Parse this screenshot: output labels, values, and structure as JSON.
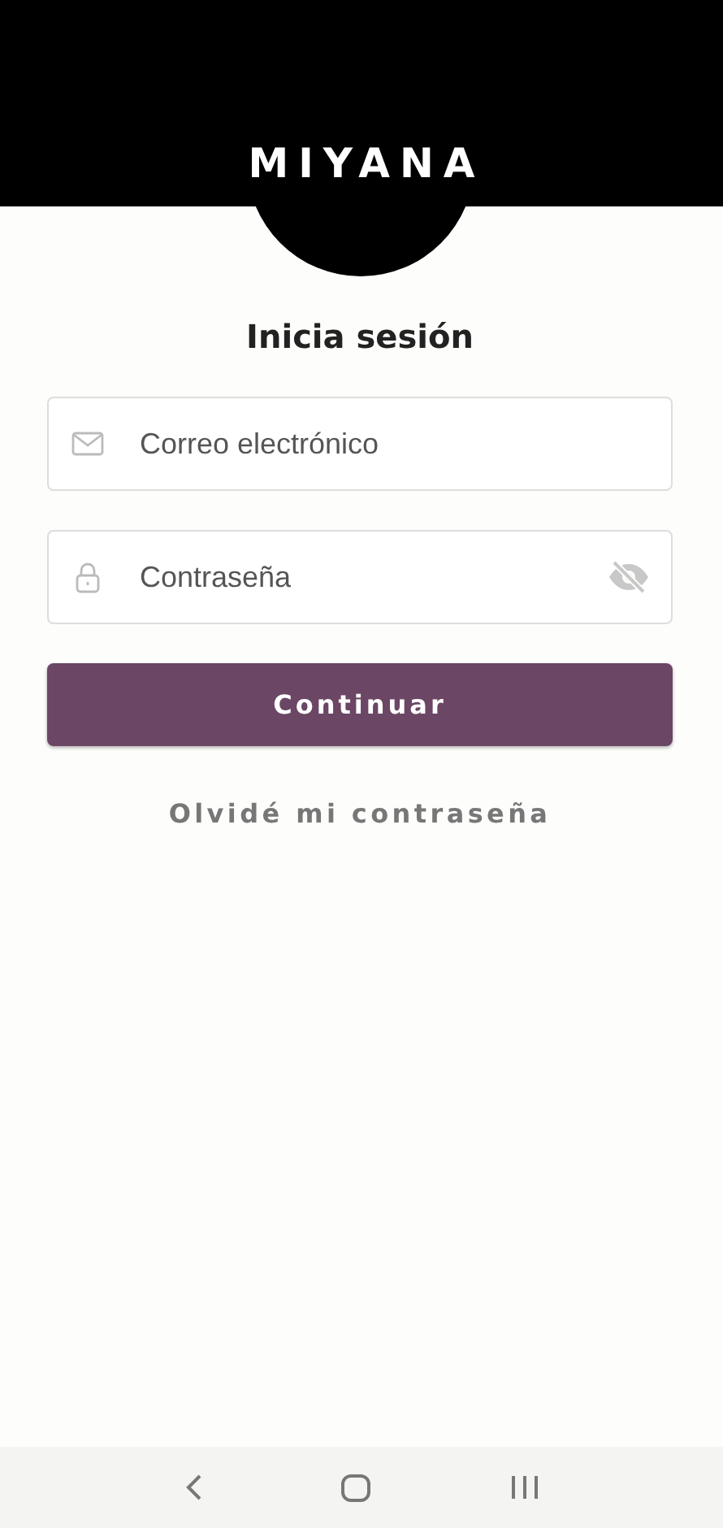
{
  "logo": "MIYANA",
  "title": "Inicia sesión",
  "fields": [
    {
      "kind": "email",
      "placeholder": "Correo electrónico"
    },
    {
      "kind": "password",
      "placeholder": "Contraseña"
    }
  ],
  "button": "Continuar",
  "link": "Olvidé mi contraseña"
}
